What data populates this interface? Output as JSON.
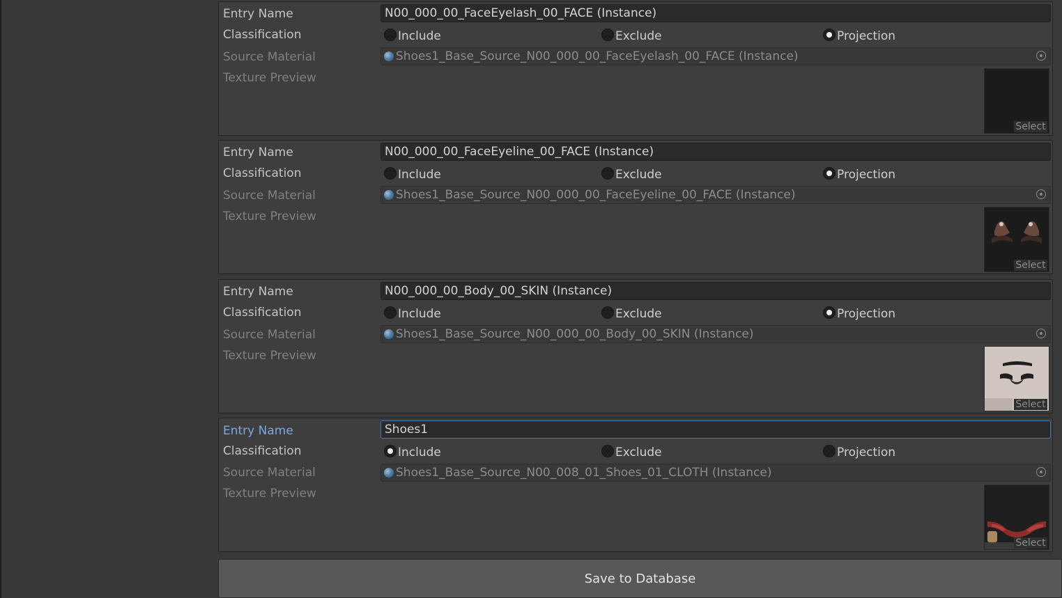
{
  "entries": [
    {
      "entry_name_label": "Entry Name",
      "entry_name_value": "N00_000_00_FaceEyelash_00_FACE (Instance)",
      "classification_label": "Classification",
      "options": [
        "Include",
        "Exclude",
        "Projection"
      ],
      "selected": "Projection",
      "source_material_label": "Source Material",
      "source_material_value": "Shoes1_Base_Source_N00_000_00_FaceEyelash_00_FACE (Instance)",
      "texture_preview_label": "Texture Preview",
      "select_label": "Select",
      "thumbnail": "dark-blank"
    },
    {
      "entry_name_label": "Entry Name",
      "entry_name_value": "N00_000_00_FaceEyeline_00_FACE (Instance)",
      "classification_label": "Classification",
      "options": [
        "Include",
        "Exclude",
        "Projection"
      ],
      "selected": "Projection",
      "source_material_label": "Source Material",
      "source_material_value": "Shoes1_Base_Source_N00_000_00_FaceEyeline_00_FACE (Instance)",
      "texture_preview_label": "Texture Preview",
      "select_label": "Select",
      "thumbnail": "eyeline-shapes"
    },
    {
      "entry_name_label": "Entry Name",
      "entry_name_value": "N00_000_00_Body_00_SKIN (Instance)",
      "classification_label": "Classification",
      "options": [
        "Include",
        "Exclude",
        "Projection"
      ],
      "selected": "Projection",
      "source_material_label": "Source Material",
      "source_material_value": "Shoes1_Base_Source_N00_000_00_Body_00_SKIN (Instance)",
      "texture_preview_label": "Texture Preview",
      "select_label": "Select",
      "thumbnail": "skin-texture"
    },
    {
      "entry_name_label": "Entry Name",
      "entry_name_value": "Shoes1",
      "classification_label": "Classification",
      "options": [
        "Include",
        "Exclude",
        "Projection"
      ],
      "selected": "Include",
      "source_material_label": "Source Material",
      "source_material_value": "Shoes1_Base_Source_N00_008_01_Shoes_01_CLOTH (Instance)",
      "texture_preview_label": "Texture Preview",
      "select_label": "Select",
      "thumbnail": "shoes-texture",
      "focused": true
    }
  ],
  "save_button_label": "Save to Database",
  "colors": {
    "panel_bg": "#3e3e3e",
    "focus_accent": "#3a79bb",
    "focus_label": "#7aa8e6"
  }
}
